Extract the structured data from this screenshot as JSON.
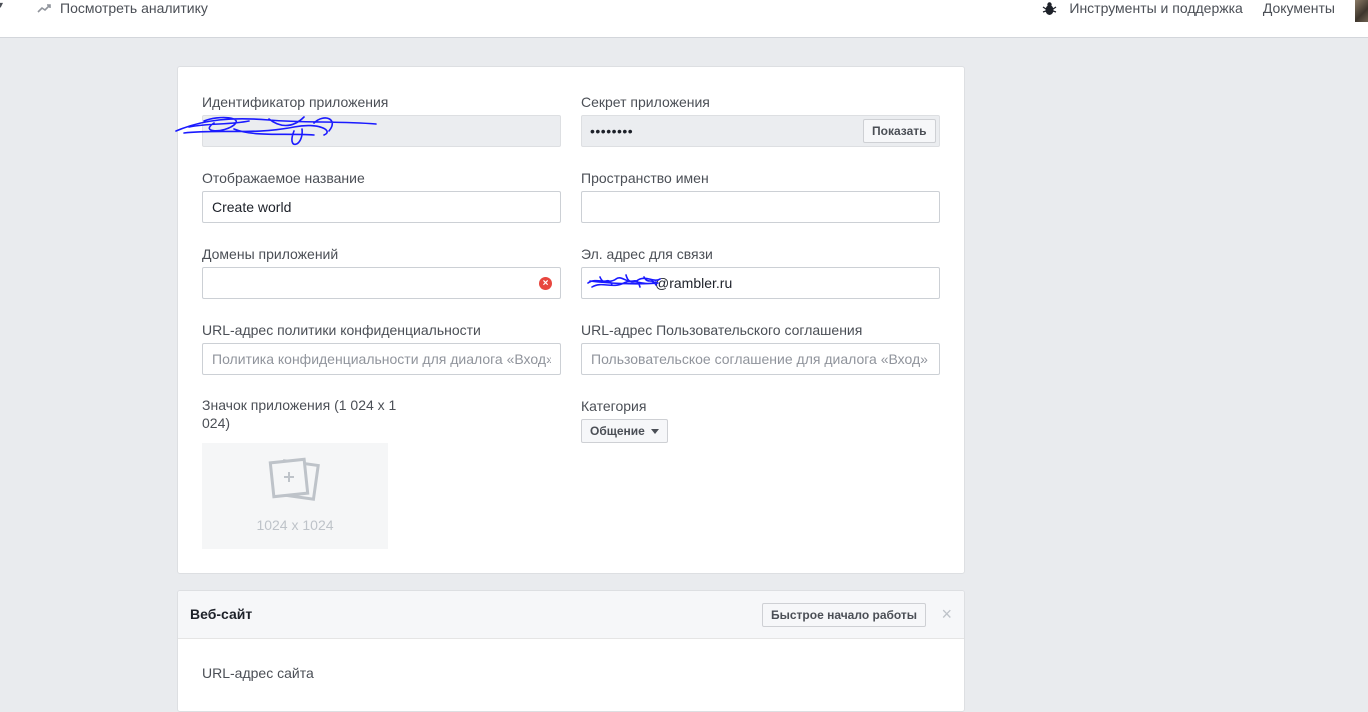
{
  "topbar": {
    "analytics_label": "Посмотреть аналитику",
    "tools_label": "Инструменты и поддержка",
    "docs_label": "Документы"
  },
  "basic": {
    "app_id": {
      "label": "Идентификатор приложения",
      "value": ""
    },
    "app_secret": {
      "label": "Секрет приложения",
      "value": "••••••••",
      "show_button": "Показать"
    },
    "display_name": {
      "label": "Отображаемое название",
      "value": "Create world"
    },
    "namespace": {
      "label": "Пространство имен",
      "value": ""
    },
    "app_domains": {
      "label": "Домены приложений",
      "value": ""
    },
    "contact_email": {
      "label": "Эл. адрес для связи",
      "value": "@rambler.ru"
    },
    "privacy_url": {
      "label": "URL-адрес политики конфиденциальности",
      "placeholder": "Политика конфиденциальности для диалога «Вход»"
    },
    "terms_url": {
      "label": "URL-адрес Пользовательского соглашения",
      "placeholder": "Пользовательское соглашение для диалога «Вход»"
    },
    "app_icon": {
      "label": "Значок приложения (1 024 x 1 024)",
      "size_text": "1024 x 1024"
    },
    "category": {
      "label": "Категория",
      "value": "Общение"
    }
  },
  "website": {
    "title": "Веб-сайт",
    "quickstart_button": "Быстрое начало работы",
    "site_url_label": "URL-адрес сайта"
  },
  "colors": {
    "scribble": "#1a1aff",
    "error": "#e8463f"
  }
}
